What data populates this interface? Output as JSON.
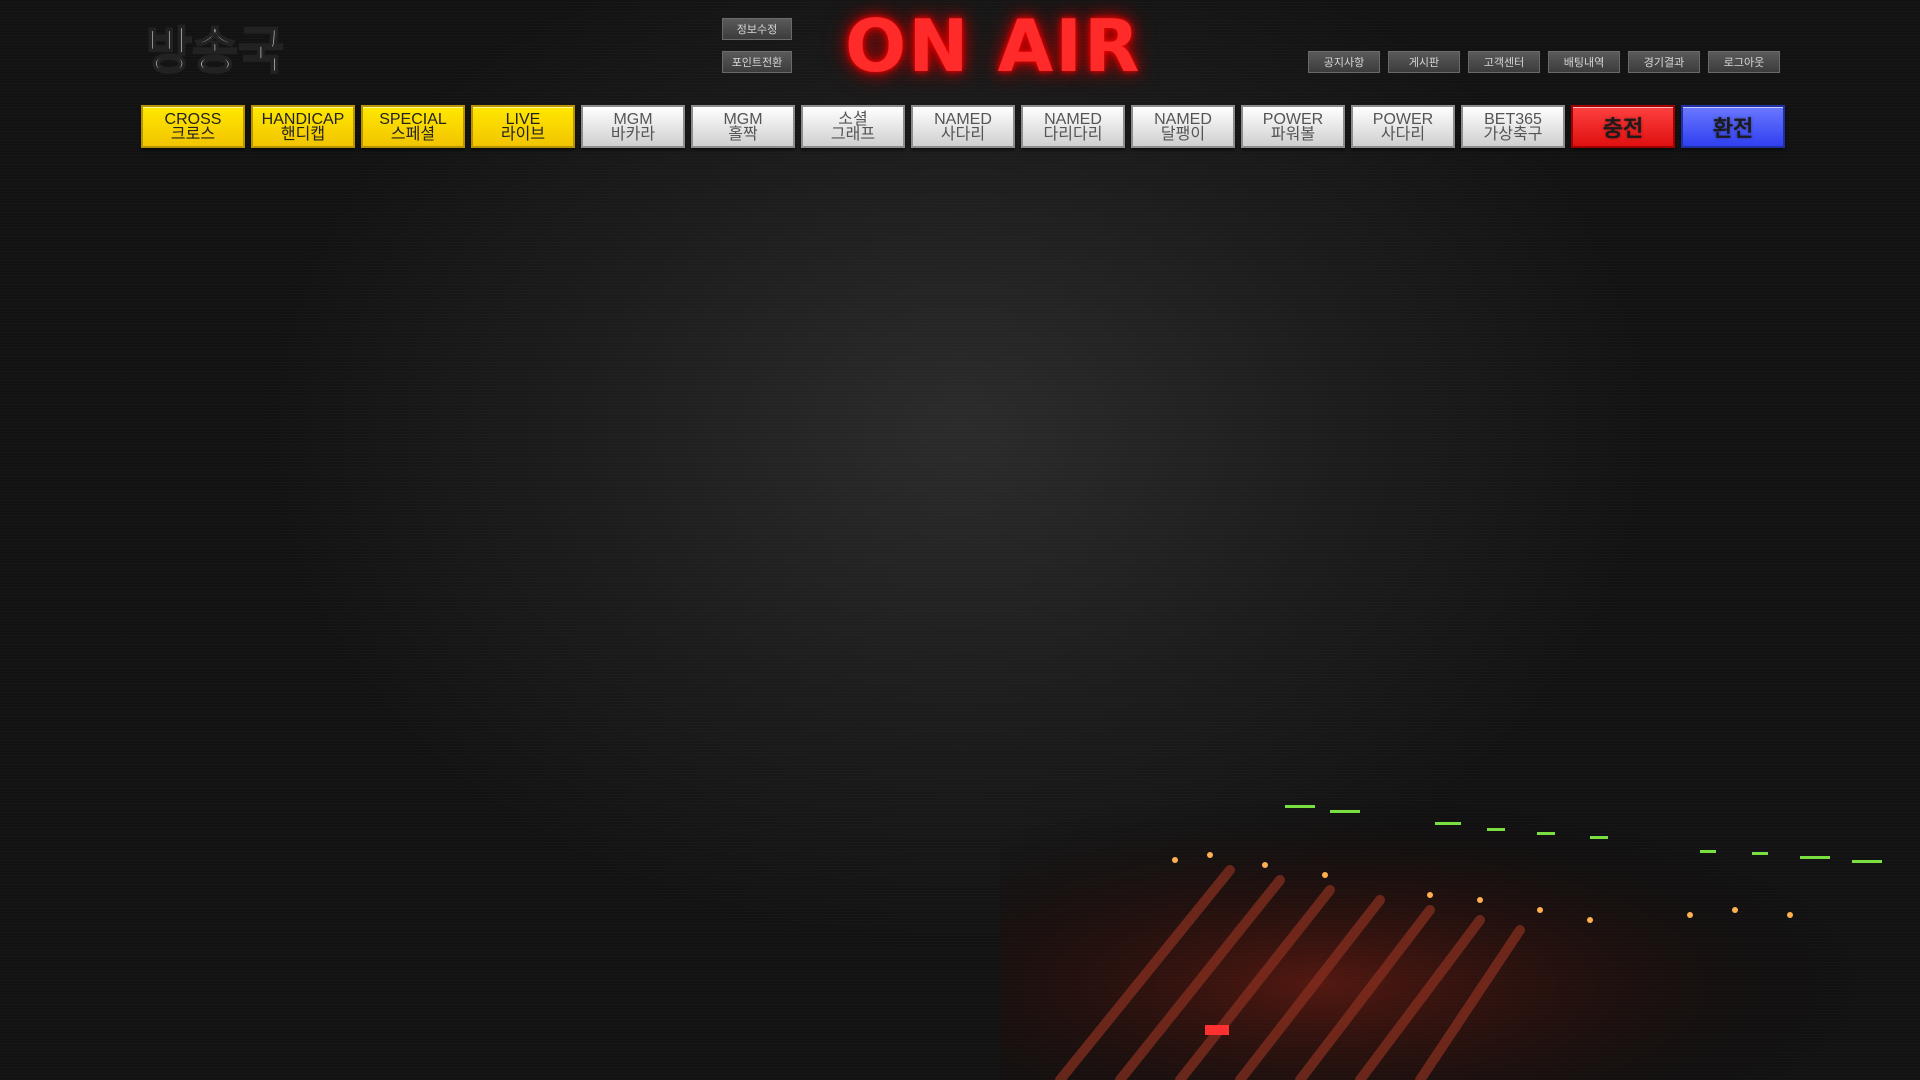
{
  "brand": {
    "logo_text": "방송국"
  },
  "header": {
    "on_air": "ON AIR"
  },
  "account_buttons": [
    "정보수정",
    "포인트전환"
  ],
  "user_menu": [
    "공지사항",
    "게시판",
    "고객센터",
    "배팅내역",
    "경기결과",
    "로그아웃"
  ],
  "games": [
    {
      "en": "CROSS",
      "ko": "크로스"
    },
    {
      "en": "HANDICAP",
      "ko": "핸디캡"
    },
    {
      "en": "SPECIAL",
      "ko": "스페셜"
    },
    {
      "en": "LIVE",
      "ko": "라이브"
    },
    {
      "en": "MGM",
      "ko": "바카라"
    },
    {
      "en": "MGM",
      "ko": "홀짝"
    },
    {
      "en": "소셜",
      "ko": "그래프"
    },
    {
      "en": "NAMED",
      "ko": "사다리"
    },
    {
      "en": "NAMED",
      "ko": "다리다리"
    },
    {
      "en": "NAMED",
      "ko": "달팽이"
    },
    {
      "en": "POWER",
      "ko": "파워볼"
    },
    {
      "en": "POWER",
      "ko": "사다리"
    },
    {
      "en": "BET365",
      "ko": "가상축구"
    }
  ],
  "money": {
    "deposit": "충전",
    "withdraw": "환전"
  },
  "colors": {
    "accent_yellow": "#ffe100",
    "deposit_red": "#ff2a2a",
    "withdraw_blue": "#4a58ff",
    "onair_red": "#ff2a2a"
  }
}
